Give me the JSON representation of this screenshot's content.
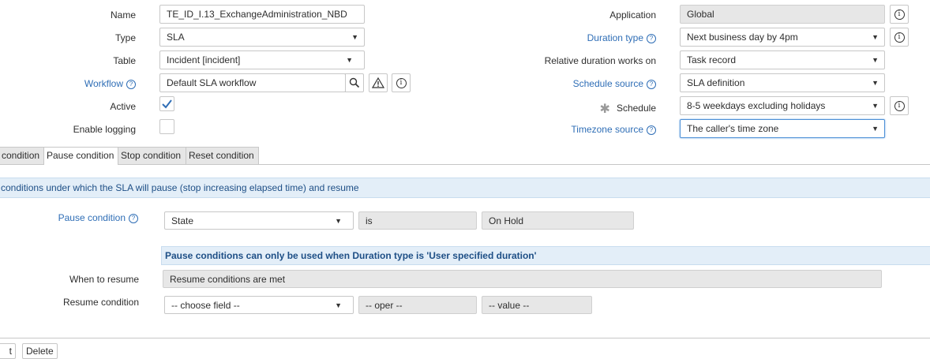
{
  "form": {
    "left": {
      "name": {
        "label": "Name",
        "value": "TE_ID_I.13_ExchangeAdministration_NBD"
      },
      "type": {
        "label": "Type",
        "value": "SLA"
      },
      "table": {
        "label": "Table",
        "value": "Incident [incident]"
      },
      "workflow": {
        "label": "Workflow",
        "value": "Default SLA workflow"
      },
      "active": {
        "label": "Active",
        "checked": true
      },
      "enable_logging": {
        "label": "Enable logging",
        "checked": false
      }
    },
    "right": {
      "application": {
        "label": "Application",
        "value": "Global"
      },
      "duration_type": {
        "label": "Duration type",
        "value": "Next business day by 4pm"
      },
      "relative_duration": {
        "label": "Relative duration works on",
        "value": "Task record"
      },
      "schedule_source": {
        "label": "Schedule source",
        "value": "SLA definition"
      },
      "schedule": {
        "label": "Schedule",
        "value": "8-5 weekdays excluding holidays"
      },
      "timezone_source": {
        "label": "Timezone source",
        "value": "The caller's time zone"
      }
    },
    "help_glyph": "?",
    "info_glyph": "i",
    "caret_glyph": "▼",
    "required_glyph": "✱"
  },
  "tabs": [
    {
      "label": "condition",
      "active": false
    },
    {
      "label": "Pause condition",
      "active": true
    },
    {
      "label": "Stop condition",
      "active": false
    },
    {
      "label": "Reset condition",
      "active": false
    }
  ],
  "pause_section": {
    "heading": "conditions under which the SLA will pause (stop increasing elapsed time) and resume",
    "pause_condition": {
      "label": "Pause condition",
      "field": "State",
      "operator": "is",
      "value": "On Hold"
    },
    "warning": "Pause conditions can only be used when Duration type is 'User specified duration'",
    "when_to_resume": {
      "label": "When to resume",
      "value": "Resume conditions are met"
    },
    "resume_condition": {
      "label": "Resume condition",
      "field": "-- choose field --",
      "operator": "-- oper --",
      "value": "-- value --"
    }
  },
  "bottom_buttons": [
    "t",
    "Delete"
  ],
  "colors": {
    "link": "#2f6eb6",
    "banner_bg": "#e3eef8",
    "banner_text": "#1e4f86",
    "check": "#2f6eb6"
  }
}
